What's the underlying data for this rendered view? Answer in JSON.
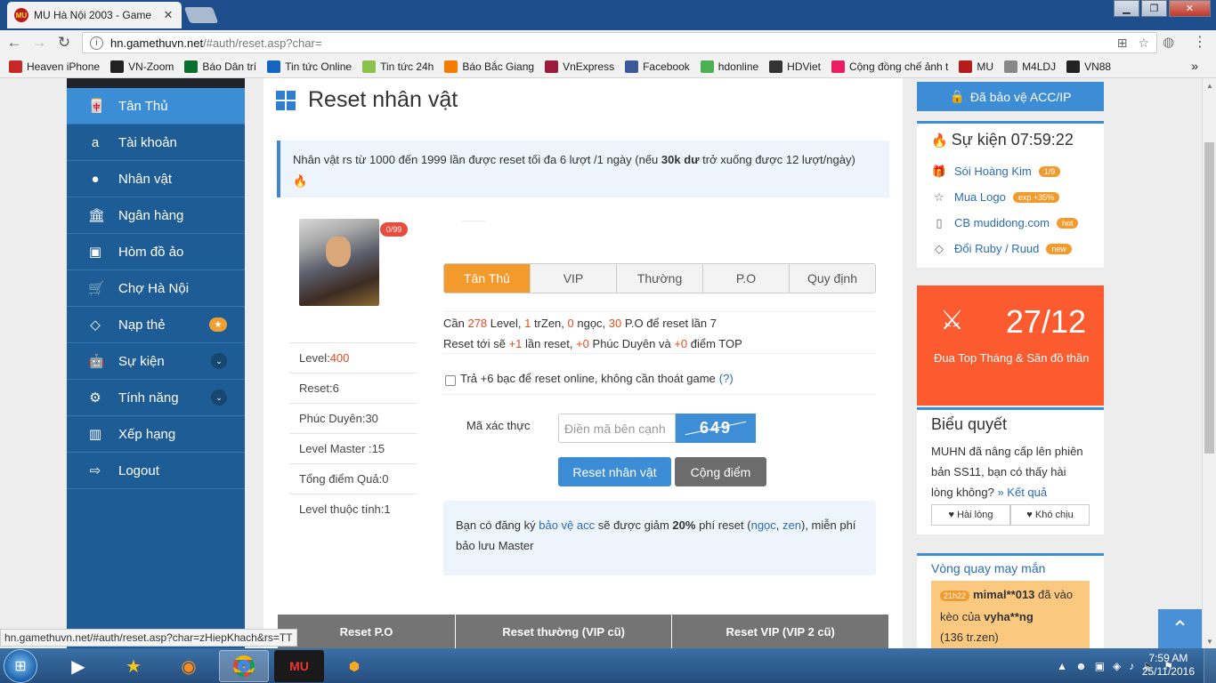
{
  "browser": {
    "tab_title": "MU Hà Nội 2003 - Game",
    "tab_icon_text": "MU",
    "url_host": "hn.gamethuvn.net",
    "url_path": "/#auth/reset.asp?char=",
    "bookmarks": [
      {
        "label": "Heaven iPhone",
        "color": "#c62828",
        "icon": "apple-icon"
      },
      {
        "label": "VN-Zoom",
        "color": "#222222",
        "icon": "vnzoom-icon"
      },
      {
        "label": "Báo Dân trí",
        "color": "#0a6e2e",
        "icon": "dantri-icon"
      },
      {
        "label": "Tin tức Online",
        "color": "#1565c0",
        "icon": "news-icon"
      },
      {
        "label": "Tin tức 24h",
        "color": "#8bc34a",
        "icon": "24h-icon"
      },
      {
        "label": "Báo Bắc Giang",
        "color": "#f57c00",
        "icon": "bacgiang-icon"
      },
      {
        "label": "VnExpress",
        "color": "#9c1b3d",
        "icon": "vnexpress-icon"
      },
      {
        "label": "Facebook",
        "color": "#3b5998",
        "icon": "facebook-icon"
      },
      {
        "label": "hdonline",
        "color": "#4caf50",
        "icon": "hdonline-icon"
      },
      {
        "label": "HDViet",
        "color": "#333333",
        "icon": "hdviet-icon"
      },
      {
        "label": "Cộng đồng chế ảnh t",
        "color": "#e91e63",
        "icon": "smile-icon"
      },
      {
        "label": "MU",
        "color": "#b71c1c",
        "icon": "mu-icon"
      },
      {
        "label": "M4LDJ",
        "color": "#888888",
        "icon": "folder-icon"
      },
      {
        "label": "VN88",
        "color": "#222222",
        "icon": "vn88-icon"
      }
    ],
    "overflow": "»"
  },
  "sidebar": {
    "items": [
      {
        "label": "Tân Thủ",
        "icon": "newbie-icon",
        "glyph": "🀄",
        "active": true
      },
      {
        "label": "Tài khoản",
        "icon": "account-icon",
        "glyph": "a"
      },
      {
        "label": "Nhân vật",
        "icon": "user-icon",
        "glyph": "●"
      },
      {
        "label": "Ngân hàng",
        "icon": "bank-icon",
        "glyph": "🏛"
      },
      {
        "label": "Hòm đồ ảo",
        "icon": "briefcase-icon",
        "glyph": "▣"
      },
      {
        "label": "Chợ Hà Nội",
        "icon": "cart-icon",
        "glyph": "🛒"
      },
      {
        "label": "Nạp thẻ",
        "icon": "diamond-icon",
        "glyph": "◇",
        "badge": "★"
      },
      {
        "label": "Sự kiện",
        "icon": "android-icon",
        "glyph": "🤖",
        "chevron": "⌄"
      },
      {
        "label": "Tính năng",
        "icon": "gears-icon",
        "glyph": "⚙",
        "chevron": "⌄"
      },
      {
        "label": "Xếp hạng",
        "icon": "bar-chart-icon",
        "glyph": "▥"
      },
      {
        "label": "Logout",
        "icon": "logout-icon",
        "glyph": "⇨"
      }
    ]
  },
  "main": {
    "title": "Reset nhân vật",
    "notice_a": "Nhân vật rs từ 1000 đến 1999 lần được reset tối đa 6 lượt /1 ngày (nếu ",
    "notice_b": "30k dư",
    "notice_c": " trở xuống được 12 lượt/ngày)",
    "reset_badge": "0/99",
    "stats": [
      {
        "label": "Level: ",
        "value": "400",
        "highlight": true
      },
      {
        "label": "Reset: ",
        "value": "6"
      },
      {
        "label": "Phúc Duyên: ",
        "value": "30"
      },
      {
        "label": "Level Master : ",
        "value": "15"
      },
      {
        "label": "Tổng điểm Quả: ",
        "value": "0"
      },
      {
        "label": "Level thuộc tính: ",
        "value": "1"
      }
    ],
    "tabs": [
      "Tân Thủ",
      "VIP",
      "Thường",
      "P.O",
      "Quy định"
    ],
    "req": {
      "l1_a": "Cần ",
      "level": "278",
      "l1_b": " Level, ",
      "zen": "1",
      "l1_c": " trZen, ",
      "ngoc": "0",
      "l1_d": " ngọc, ",
      "po": "30",
      "l1_e": " P.O để reset lần 7",
      "l2_a": "Reset tới sẽ ",
      "plus_reset": "+1",
      "l2_b": " lần reset, ",
      "plus_pd": "+0",
      "l2_c": " Phúc Duyên và ",
      "plus_top": "+0",
      "l2_d": " điểm TOP"
    },
    "online_reset_label": "Trả +6 bạc để reset online, không cần thoát game",
    "online_reset_help": "(?)",
    "captcha_label": "Mã xác thực",
    "captcha_placeholder": "Điền mã bên cạnh",
    "captcha_text": "649",
    "btn_reset": "Reset nhân vật",
    "btn_cong": "Cộng điểm",
    "info": {
      "a": "Bạn có đăng ký ",
      "link1": "bảo vệ acc",
      "b": " sẽ được giảm ",
      "pct": "20%",
      "c": " phí reset (",
      "link2": "ngọc",
      "d": ", ",
      "link3": "zen",
      "e": "), miễn phí bảo lưu Master"
    },
    "table_headers": [
      "Reset P.O",
      "Reset thường (VIP cũ)",
      "Reset VIP (VIP 2 cũ)"
    ]
  },
  "right": {
    "protect_btn": "Đã bảo vệ ACC/IP",
    "event_title": "Sự kiện 07:59:22",
    "events": [
      {
        "label": "Sói Hoàng Kim",
        "badge": "1/9",
        "icon": "gift-icon",
        "glyph": "🎁"
      },
      {
        "label": "Mua Logo",
        "badge": "exp +35%",
        "icon": "star-icon",
        "glyph": "☆"
      },
      {
        "label": "CB mudidong.com",
        "badge": "hot",
        "icon": "mobile-icon",
        "glyph": "▯"
      },
      {
        "label": "Đổi Ruby / Ruud",
        "badge": "new",
        "icon": "gem-icon",
        "glyph": "◇"
      }
    ],
    "promo_date": "27/12",
    "promo_text": "Đua Top Tháng & Săn đồ thần",
    "poll_title": "Biểu quyết",
    "poll_question": "MUHN đã nâng cấp lên phiên bản SS11, bạn có thấy hài lòng không? ",
    "poll_result_link": "» Kết quả",
    "poll_yes": "♥ Hài lòng",
    "poll_no": "♥ Khó chịu",
    "wheel_title": "Vòng quay may mắn",
    "wheel_time": "21h22",
    "wheel_user": "mimal**013",
    "wheel_mid": " đã vào kèo của ",
    "wheel_target": "vyha**ng",
    "wheel_amount": "(136 tr.zen)"
  },
  "status_url": "hn.gamethuvn.net/#auth/reset.asp?char=zHiepKhach&rs=TT",
  "taskbar": {
    "time": "7:59 AM",
    "date": "25/11/2016"
  }
}
